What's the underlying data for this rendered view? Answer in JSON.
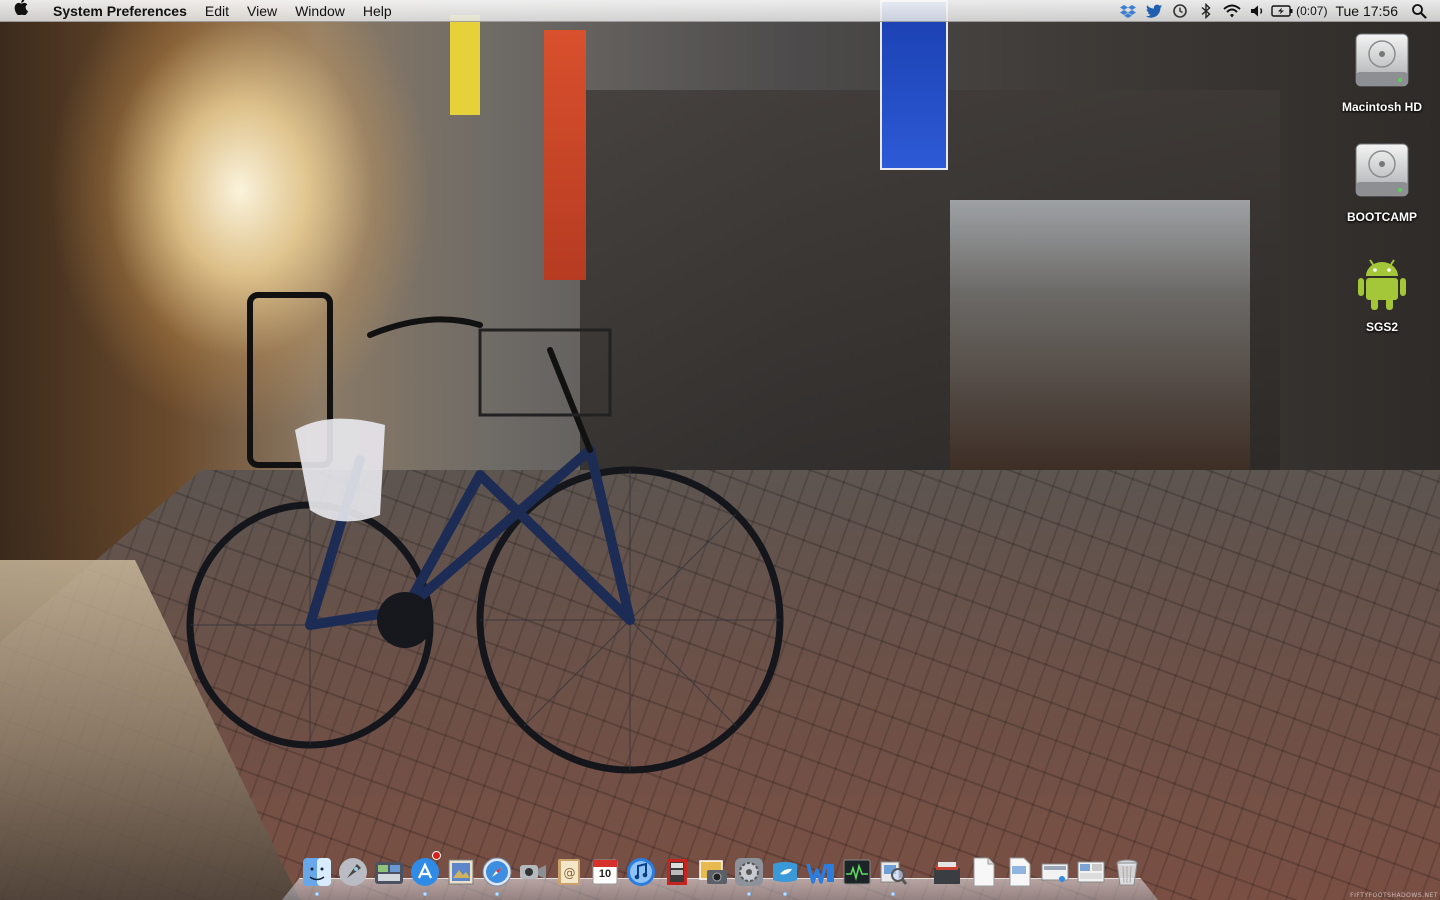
{
  "menubar": {
    "apple_icon": "apple-logo",
    "app_name": "System Preferences",
    "menus": [
      "Edit",
      "View",
      "Window",
      "Help"
    ],
    "status": {
      "battery_text": "(0:07)",
      "clock": "Tue 17:56"
    }
  },
  "desktop": {
    "icons": [
      {
        "label": "Macintosh HD",
        "icon": "hard-drive-icon"
      },
      {
        "label": "BOOTCAMP",
        "icon": "hard-drive-icon"
      },
      {
        "label": "SGS2",
        "icon": "android-icon"
      }
    ]
  },
  "dock": {
    "calendar_day": "10",
    "apps": [
      "finder",
      "launchpad",
      "mission-control",
      "app-store",
      "preview",
      "safari",
      "facetime",
      "contacts",
      "ical",
      "itunes",
      "photo-booth",
      "iphoto",
      "system-preferences",
      "twitter",
      "word",
      "activity-monitor",
      "preview-2",
      "documents",
      "plist",
      "pdf",
      "screenshot",
      "screenshot-2",
      "trash"
    ]
  },
  "watermark": "FIFTYFOOTSHADOWS.NET",
  "colors": {
    "menubar_bg": "#e8e8e8",
    "accent_blue": "#2d5ad6",
    "android_green": "#a4c639",
    "badge_red": "#d6201a"
  }
}
